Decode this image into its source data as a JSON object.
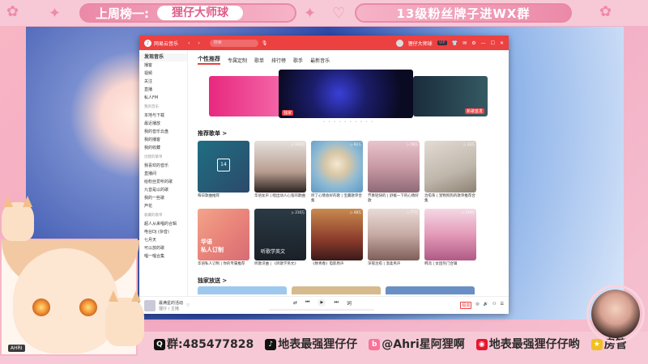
{
  "stream": {
    "banner_left_title": "上周榜一:",
    "banner_left_name": "狸仔大师球",
    "banner_right": "13级粉丝牌子进WX群"
  },
  "ncm": {
    "app_name": "网易云音乐",
    "search_placeholder": "搜索",
    "user_name": "狸仔大师球",
    "vip": "VIP",
    "sidebar": [
      {
        "label": "发现音乐",
        "active": true
      },
      {
        "label": "播客"
      },
      {
        "label": "视频"
      },
      {
        "label": "关注"
      },
      {
        "label": "直播"
      },
      {
        "label": "私人FM"
      }
    ],
    "sidebar_my_head": "我的音乐",
    "sidebar_my": [
      "本地与下载",
      "最近播放",
      "我的音乐云盘",
      "我的播客",
      "我的收藏"
    ],
    "sidebar_created_head": "创建的歌单",
    "sidebar_created": [
      "我喜欢的音乐",
      "直播间",
      "给粉丝爱听的歌",
      "九音是以的歌",
      "我的一些歌",
      "芦花"
    ],
    "sidebar_collected_head": "收藏的歌单",
    "sidebar_collected": [
      "超人从来唱的合辑",
      "电台DJ (杂音)",
      "七月天",
      "可以放的歌",
      "唱一唱合集"
    ],
    "tabs": [
      "个性推荐",
      "专属定制",
      "歌单",
      "排行榜",
      "歌手",
      "最新音乐"
    ],
    "carousel_badge": "独家",
    "carousel_badge_right": "新歌首发",
    "carousel_dots": "• • • • • • • • • •",
    "recommend_title": "推荐歌单 >",
    "calendar_day": "14",
    "playlists_row1": [
      {
        "caption": "每日歌曲推荐",
        "count": ""
      },
      {
        "caption": "华语女声 | 唱出动人心弦的歌曲",
        "count": "▷ 165万"
      },
      {
        "caption": "听了心情会好的歌 | 宝藏歌单合集",
        "count": "▷ 92万"
      },
      {
        "caption": "节奏轻快的 | 舒缓一下的心情好歌",
        "count": "▷ 56万"
      },
      {
        "caption": "治愈系 | 宠物狗狗的歌单推荐合集",
        "count": "▷ 33万"
      }
    ],
    "playlists_row2": [
      {
        "caption": "华语私人订制 | 你的专属推荐",
        "count": "",
        "overlay": "华语\n私人订制"
      },
      {
        "caption": "听歌识曲 | 《听歌学英文》",
        "count": "▷ 210万",
        "overlay": "听歌学英文"
      },
      {
        "caption": "《致青春》电影原声",
        "count": "▷ 48万"
      },
      {
        "caption": "深夜治愈 | 温柔男声",
        "count": "▷ 77万"
      },
      {
        "caption": "韩流 | 女团热门合辑",
        "count": "▷ 129万"
      }
    ],
    "exclusive_title": "独家放送 >",
    "player_song": "最满星的活动",
    "player_artist": "狸仔 / 主播",
    "player_prev": "⏮",
    "player_play": "▶",
    "player_next": "⏭",
    "player_hq": "极高",
    "colors": {
      "brand": "#ec4141"
    }
  },
  "info_strip": [
    {
      "icon": "qq-icon",
      "text": "群:485477828"
    },
    {
      "icon": "douyin-icon",
      "text": "地表最强狸仔仔"
    },
    {
      "icon": "bilibili-icon",
      "text": "@Ahri星阿狸啊"
    },
    {
      "icon": "weibo-icon",
      "text": "地表最强狸仔仔哟"
    },
    {
      "icon": "fangguan-icon",
      "text": "房管"
    }
  ],
  "logo_text": "AHRI"
}
